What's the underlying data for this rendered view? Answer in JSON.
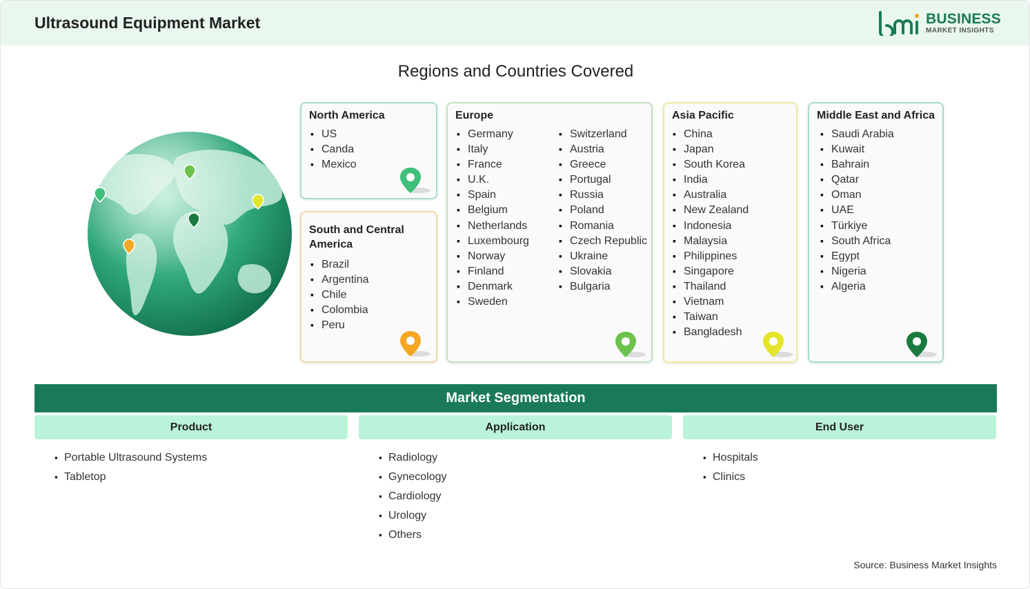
{
  "header": {
    "title": "Ultrasound Equipment Market"
  },
  "logo": {
    "word": "BUSINESS",
    "sub": "MARKET INSIGHTS",
    "color": "#1b7a57"
  },
  "section": {
    "title": "Regions and Countries Covered"
  },
  "regions": {
    "north_america": {
      "name": "North America",
      "countries": [
        "US",
        "Canda",
        "Mexico"
      ],
      "pin_color": "#3fbf7a"
    },
    "south_central_america": {
      "name": "South and Central America",
      "countries": [
        "Brazil",
        "Argentina",
        "Chile",
        "Colombia",
        "Peru"
      ],
      "pin_color": "#f5a623"
    },
    "europe": {
      "name": "Europe",
      "countries_col1": [
        "Germany",
        "Italy",
        "France",
        "U.K.",
        "Spain",
        "Belgium",
        "Netherlands",
        "Luxembourg",
        "Norway",
        "Finland",
        "Denmark",
        "Sweden"
      ],
      "countries_col2": [
        "Switzerland",
        "Austria",
        "Greece",
        "Portugal",
        "Russia",
        "Poland",
        "Romania",
        "Czech Republic",
        "Ukraine",
        "Slovakia",
        "Bulgaria"
      ],
      "pin_color": "#6cc24a"
    },
    "asia_pacific": {
      "name": "Asia Pacific",
      "countries": [
        "China",
        "Japan",
        "South Korea",
        "India",
        "Australia",
        "New Zealand",
        "Indonesia",
        "Malaysia",
        "Philippines",
        "Singapore",
        "Thailand",
        "Vietnam",
        "Taiwan",
        "Bangladesh"
      ],
      "pin_color": "#e4e42a"
    },
    "middle_east_africa": {
      "name": "Middle East and Africa",
      "countries": [
        "Saudi Arabia",
        "Kuwait",
        "Bahrain",
        "Qatar",
        "Oman",
        "UAE",
        "Türkiye",
        "South Africa",
        "Egypt",
        "Nigeria",
        "Algeria"
      ],
      "pin_color": "#1a7a3f"
    }
  },
  "segmentation": {
    "title": "Market Segmentation",
    "bar_color": "#1a7a57",
    "columns": [
      {
        "heading": "Product",
        "items": [
          "Portable Ultrasound Systems",
          "Tabletop"
        ]
      },
      {
        "heading": "Application",
        "items": [
          "Radiology",
          "Gynecology",
          "Cardiology",
          "Urology",
          "Others"
        ]
      },
      {
        "heading": "End User",
        "items": [
          "Hospitals",
          "Clinics"
        ]
      }
    ]
  },
  "source": "Source: Business Market Insights",
  "icons": [
    "globe-icon",
    "map-pin-icon",
    "logo-mark-icon"
  ]
}
